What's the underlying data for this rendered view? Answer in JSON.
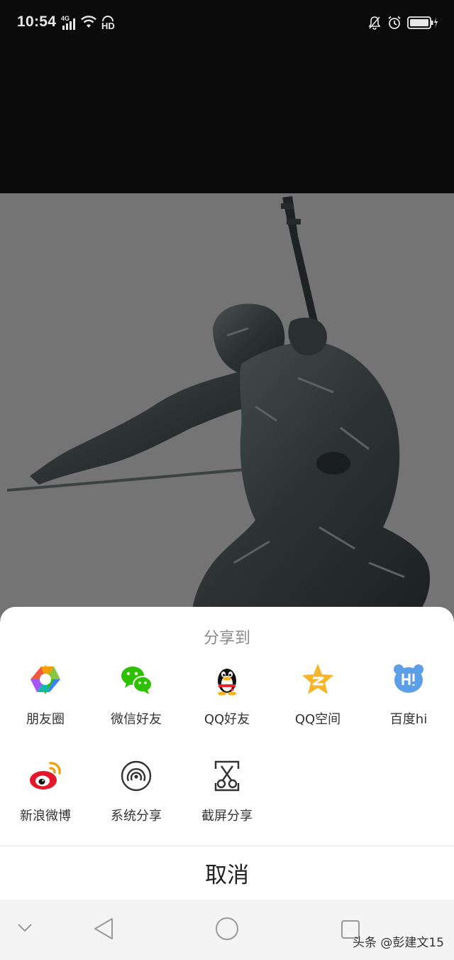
{
  "status_bar": {
    "time": "10:54",
    "network_label": "4G",
    "hd_label": "HD"
  },
  "share_sheet": {
    "title": "分享到",
    "row1": [
      {
        "label": "朋友圈",
        "icon": "moments-icon"
      },
      {
        "label": "微信好友",
        "icon": "wechat-icon"
      },
      {
        "label": "QQ好友",
        "icon": "qq-icon"
      },
      {
        "label": "QQ空间",
        "icon": "qzone-icon"
      },
      {
        "label": "百度hi",
        "icon": "baidu-hi-icon"
      }
    ],
    "row2": [
      {
        "label": "新浪微博",
        "icon": "weibo-icon"
      },
      {
        "label": "系统分享",
        "icon": "system-share-icon"
      },
      {
        "label": "截屏分享",
        "icon": "screenshot-share-icon"
      }
    ],
    "cancel_label": "取消"
  },
  "nav_bar": {
    "watermark": "头条 @彭建文15"
  },
  "colors": {
    "wechat_green": "#2dc100",
    "qzone_yellow": "#f7b52c",
    "baidu_hi_blue": "#5c9fe6",
    "weibo_red": "#e6162d"
  }
}
